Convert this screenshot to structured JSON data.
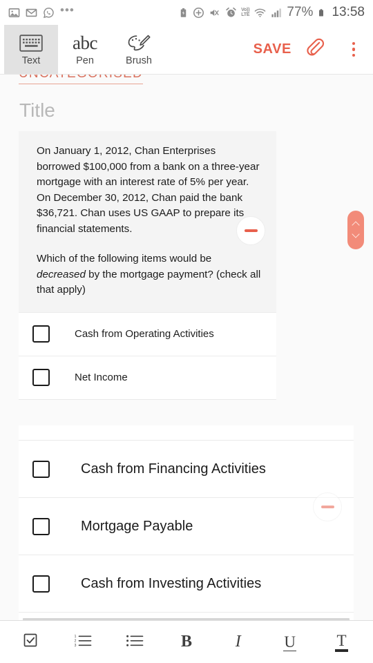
{
  "statusbar": {
    "left_icons": [
      "image-icon",
      "email-icon",
      "whatsapp-icon",
      "more-notifications-ellipsis"
    ],
    "right_icons": [
      "battery-saver-icon",
      "plus-circle-icon",
      "mute-vibrate-icon",
      "alarm-icon",
      "volte-icon",
      "wifi-icon",
      "signal-icon",
      "battery-icon"
    ],
    "volte_top": "Vo))",
    "volte_bottom": "LTE",
    "battery_percent": "77%",
    "time": "13:58"
  },
  "toolbar": {
    "tools": [
      {
        "label": "Text",
        "icon": "keyboard-icon",
        "active": true
      },
      {
        "label": "Pen",
        "icon": "abc-icon",
        "active": false
      },
      {
        "label": "Brush",
        "icon": "paint-brush-icon",
        "active": false
      }
    ],
    "save_label": "SAVE",
    "attach_icon": "paperclip-icon",
    "overflow_icon": "kebab-menu-icon"
  },
  "document": {
    "category": "UNCATEGORISED",
    "title_placeholder": "Title",
    "question": {
      "paragraph1": "On January 1, 2012, Chan Enterprises borrowed $100,000 from a bank on a three-year mortgage with an interest rate of 5% per year.  On December 30, 2012, Chan paid the bank $36,721. Chan uses US GAAP to prepare its financial statements.",
      "paragraph2_before": "Which of the following items would be ",
      "paragraph2_italic": "decreased",
      "paragraph2_after": " by the mortgage payment? (check all that apply)"
    },
    "options_small": [
      {
        "label": "Cash from Operating Activities",
        "checked": false
      },
      {
        "label": "Net Income",
        "checked": false
      }
    ],
    "options_large": [
      {
        "label": "Cash from Financing Activities",
        "checked": false
      },
      {
        "label": "Mortgage Payable",
        "checked": false
      },
      {
        "label": "Cash from Investing Activities",
        "checked": false
      }
    ],
    "remove_buttons": [
      {
        "name": "remove-question-block",
        "icon": "minus-circle-icon"
      },
      {
        "name": "remove-options-block",
        "icon": "minus-circle-icon"
      }
    ],
    "scroll_handle": {
      "up_icon": "chevron-up-icon",
      "down_icon": "chevron-down-icon"
    }
  },
  "formatbar": {
    "buttons": [
      {
        "name": "checkbox-list-button",
        "icon": "checkbox-list-icon",
        "glyph": ""
      },
      {
        "name": "numbered-list-button",
        "icon": "numbered-list-icon",
        "glyph": ""
      },
      {
        "name": "bulleted-list-button",
        "icon": "bulleted-list-icon",
        "glyph": ""
      },
      {
        "name": "bold-button",
        "icon": "bold-icon",
        "glyph": "B"
      },
      {
        "name": "italic-button",
        "icon": "italic-icon",
        "glyph": "I"
      },
      {
        "name": "underline-button",
        "icon": "underline-icon",
        "glyph": "U"
      },
      {
        "name": "text-color-button",
        "icon": "text-color-icon",
        "glyph": "T"
      }
    ]
  },
  "colors": {
    "accent": "#e8604c",
    "handle": "#f28b79",
    "page_bg": "#fafafa",
    "card_bg": "#ffffff",
    "question_bg": "#f4f4f4"
  }
}
